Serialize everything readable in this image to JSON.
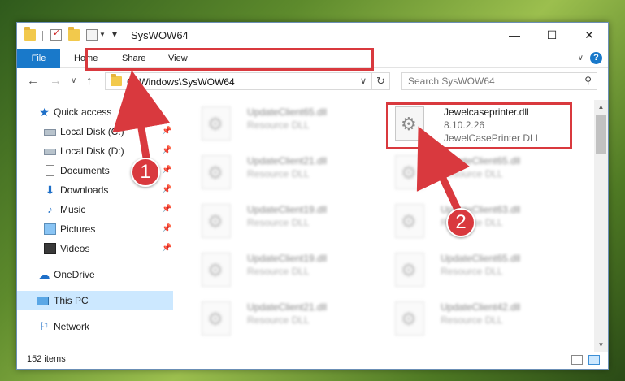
{
  "window": {
    "title": "SysWOW64",
    "minimize_icon": "minimize-icon",
    "maximize_icon": "maximize-icon",
    "close_icon": "close-icon",
    "minimize_glyph": "—",
    "maximize_glyph": "☐",
    "close_glyph": "✕"
  },
  "ribbon": {
    "tabs": [
      {
        "label": "File"
      },
      {
        "label": "Home"
      },
      {
        "label": "Share"
      },
      {
        "label": "View"
      }
    ],
    "help_glyph": "?",
    "chevron_glyph": "∨"
  },
  "navigation": {
    "back_glyph": "←",
    "forward_glyph": "→",
    "recent_glyph": "∨",
    "up_glyph": "↑",
    "address": "C:\\Windows\\SysWOW64",
    "dropdown_glyph": "∨",
    "refresh_glyph": "↻",
    "search_placeholder": "Search SysWOW64",
    "search_glyph": "⚲"
  },
  "sidebar": {
    "items": [
      {
        "label": "Quick access",
        "icon": "star-icon",
        "glyph": "★"
      },
      {
        "label": "Local Disk (C:)",
        "icon": "drive-icon",
        "pinned": true
      },
      {
        "label": "Local Disk (D:)",
        "icon": "drive-icon",
        "pinned": true
      },
      {
        "label": "Documents",
        "icon": "documents-icon",
        "pinned": true
      },
      {
        "label": "Downloads",
        "icon": "downloads-icon",
        "glyph": "⬇",
        "pinned": true
      },
      {
        "label": "Music",
        "icon": "music-icon",
        "glyph": "♪",
        "pinned": true
      },
      {
        "label": "Pictures",
        "icon": "pictures-icon",
        "pinned": true
      },
      {
        "label": "Videos",
        "icon": "videos-icon",
        "pinned": true
      },
      {
        "label": "OneDrive",
        "icon": "onedrive-icon",
        "glyph": "☁"
      },
      {
        "label": "This PC",
        "icon": "this-pc-icon",
        "selected": true
      },
      {
        "label": "Network",
        "icon": "network-icon",
        "glyph": "⚐"
      }
    ],
    "pin_glyph": "📌"
  },
  "files": {
    "left_column": [
      {
        "name": "UpdateClient65.dll",
        "desc": "Resource DLL"
      },
      {
        "name": "UpdateClient21.dll",
        "desc": "Resource DLL"
      },
      {
        "name": "UpdateClient19.dll",
        "desc": "Resource DLL"
      },
      {
        "name": "UpdateClient19.dll",
        "desc": "Resource DLL"
      },
      {
        "name": "UpdateClient21.dll",
        "desc": "Resource DLL"
      }
    ],
    "right_column": [
      {
        "name": "Jewelcaseprinter.dll",
        "version": "8.10.2.26",
        "desc": "JewelCasePrinter DLL"
      },
      {
        "name": "UpdateClient65.dll",
        "desc": "Resource DLL"
      },
      {
        "name": "UpdateClient63.dll",
        "desc": "Resource DLL"
      },
      {
        "name": "UpdateClient65.dll",
        "desc": "Resource DLL"
      },
      {
        "name": "UpdateClient42.dll",
        "desc": "Resource DLL"
      }
    ]
  },
  "status": {
    "item_count": "152 items"
  },
  "annotations": {
    "callout1": "1",
    "callout2": "2",
    "accent_color": "#d9393e"
  }
}
